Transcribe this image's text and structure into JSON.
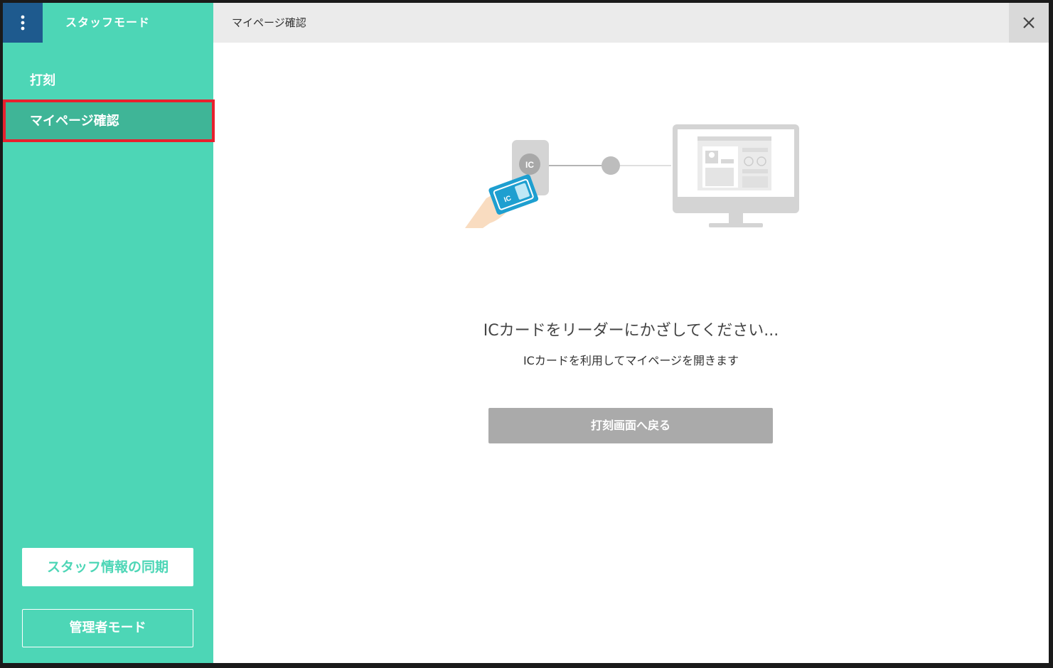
{
  "sidebar": {
    "title": "スタッフモード",
    "items": [
      {
        "label": "打刻"
      },
      {
        "label": "マイページ確認"
      }
    ],
    "sync_button": "スタッフ情報の同期",
    "admin_button": "管理者モード"
  },
  "header": {
    "title": "マイページ確認"
  },
  "main": {
    "reader_icon_text": "IC",
    "card_icon_text": "IC",
    "title": "ICカードをリーダーにかざしてください...",
    "subtitle": "ICカードを利用してマイページを開きます",
    "back_button": "打刻画面へ戻る"
  },
  "colors": {
    "sidebar": "#4dd6b6",
    "menu_button": "#1e5a8e",
    "selected_item": "#3fb597",
    "highlight_border": "#e8202e",
    "header": "#ebebeb",
    "back_button": "#aaaaaa"
  }
}
